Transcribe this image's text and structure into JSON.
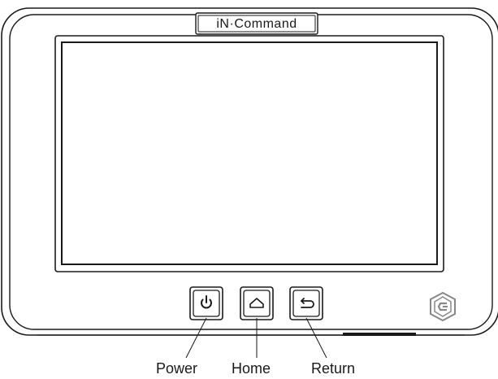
{
  "device": {
    "logo_text": "iN·Command"
  },
  "buttons": [
    {
      "id": "power",
      "icon": "power-icon",
      "callout": "Power"
    },
    {
      "id": "home",
      "icon": "home-icon",
      "callout": "Home"
    },
    {
      "id": "return",
      "icon": "return-arrow-icon",
      "callout": "Return"
    }
  ],
  "brand_badge_icon": "hexagon-c-logo-icon",
  "colors": {
    "outline": "#1a1a1a",
    "screen_fill": "#ffffff",
    "badge": "#888888"
  }
}
